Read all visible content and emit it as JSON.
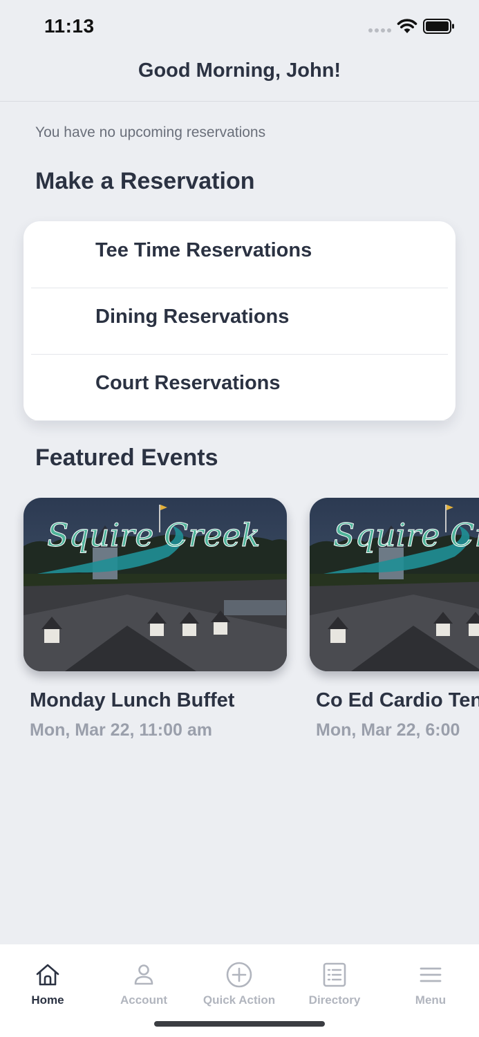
{
  "status_bar": {
    "time": "11:13"
  },
  "header": {
    "greeting": "Good Morning, John!"
  },
  "reservations": {
    "empty_message": "You have no upcoming reservations"
  },
  "make_reservation": {
    "title": "Make a Reservation",
    "items": [
      {
        "label": "Tee Time Reservations"
      },
      {
        "label": "Dining Reservations"
      },
      {
        "label": "Court Reservations"
      }
    ]
  },
  "featured_events": {
    "title": "Featured Events",
    "items": [
      {
        "title": "Monday Lunch Buffet",
        "date": "Mon, Mar 22, 11:00 am",
        "image_text": "Squire Creek"
      },
      {
        "title": "Co Ed Cardio Ten",
        "date": "Mon, Mar 22, 6:00",
        "image_text": "Squire Creek"
      }
    ]
  },
  "tab_bar": {
    "items": [
      {
        "label": "Home",
        "icon": "home-icon",
        "active": true
      },
      {
        "label": "Account",
        "icon": "person-icon",
        "active": false
      },
      {
        "label": "Quick Action",
        "icon": "plus-circle-icon",
        "active": false
      },
      {
        "label": "Directory",
        "icon": "list-icon",
        "active": false
      },
      {
        "label": "Menu",
        "icon": "hamburger-icon",
        "active": false
      }
    ]
  },
  "colors": {
    "background": "#eceef2",
    "text_primary": "#2b3242",
    "text_secondary": "#9a9fab",
    "tab_inactive": "#b1b5be",
    "logo_teal": "#1f8f96"
  }
}
